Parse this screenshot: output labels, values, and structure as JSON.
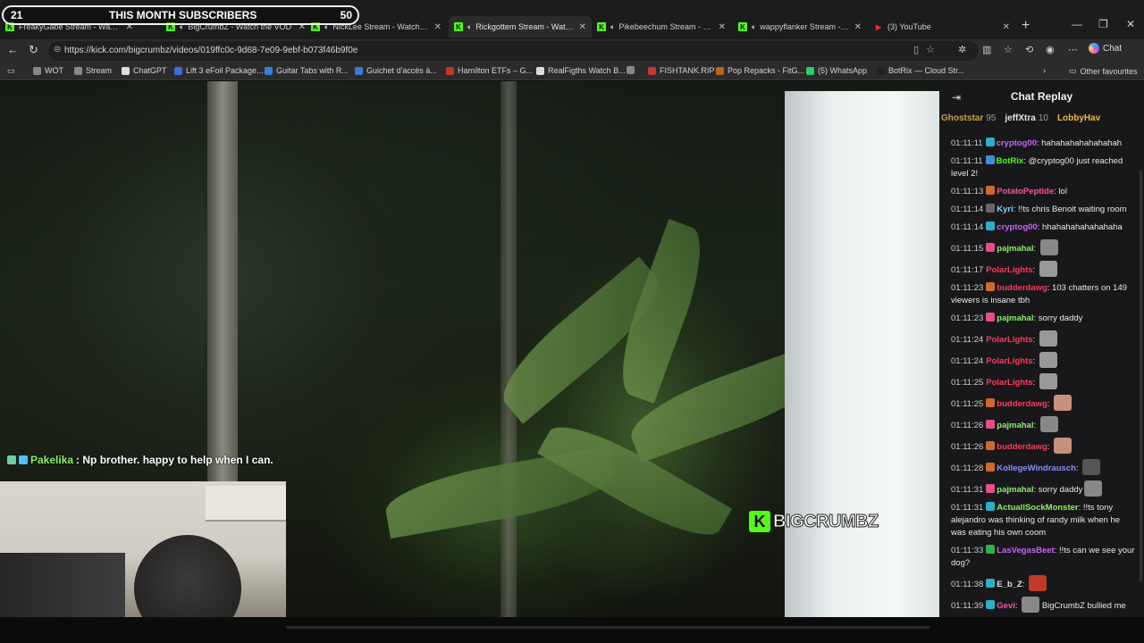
{
  "overlay": {
    "count_left": "21",
    "label": "THIS MONTH SUBSCRIBERS",
    "count_right": "50"
  },
  "tabs": [
    {
      "title": "FreakyGabe Stream - Watch",
      "icon": "kick",
      "active": false
    },
    {
      "title": "BigCrumbZ - Watch the VOD",
      "icon": "kick",
      "active": false,
      "audio": true
    },
    {
      "title": "NickLee Stream - Watch Live",
      "icon": "kick",
      "active": false,
      "audio": true
    },
    {
      "title": "Rickgottem Stream - Watch Li",
      "icon": "kick",
      "active": true,
      "audio": true
    },
    {
      "title": "Pikebeechum Stream - Watch",
      "icon": "kick",
      "active": false,
      "audio": true
    },
    {
      "title": "wappyflanker Stream - Watch",
      "icon": "kick",
      "active": false,
      "audio": true
    },
    {
      "title": "(3) YouTube",
      "icon": "youtube",
      "active": false
    }
  ],
  "address": {
    "url": "https://kick.com/bigcrumbz/videos/019ffc0c-9d68-7e09-9ebf-b073f46b9f0e"
  },
  "copilot": {
    "label": "Chat"
  },
  "bookmarks": [
    {
      "label": "WOT",
      "color": "#888"
    },
    {
      "label": "Stream",
      "color": "#888"
    },
    {
      "label": "ChatGPT",
      "color": "#ddd"
    },
    {
      "label": "Lift 3 eFoil Package...",
      "color": "#3a6fd8"
    },
    {
      "label": "Guitar Tabs with R...",
      "color": "#3c7ddc"
    },
    {
      "label": "Guichet d'accès à...",
      "color": "#3a7bd5"
    },
    {
      "label": "Hamilton ETFs – G...",
      "color": "#c0392b"
    },
    {
      "label": "RealFigths Watch B...",
      "color": "#ddd"
    },
    {
      "label": "",
      "color": "#888"
    },
    {
      "label": "FISHTANK.RIP",
      "color": "#c33"
    },
    {
      "label": "Pop Repacks - FitG...",
      "color": "#b5651d"
    },
    {
      "label": "(5) WhatsApp",
      "color": "#25d366"
    },
    {
      "label": "BotRix — Cloud Str...",
      "color": "#222"
    }
  ],
  "other_favourites": "Other favourites",
  "video": {
    "caption_name": "Pakelika",
    "caption_text": ": Np brother. happy to help when I can.",
    "watermark": "BIGCRUMBZ"
  },
  "chat": {
    "title": "Chat Replay",
    "gifters": [
      {
        "name": "Ghoststar",
        "count": "95",
        "color": "#c7a24b"
      },
      {
        "name": "jeffXtra",
        "count": "10",
        "color": "#e6e6e6"
      },
      {
        "name": "LobbyHav",
        "count": "",
        "color": "#e8b84a"
      }
    ],
    "messages": [
      {
        "time": "01:11:11",
        "name": "cryptog00",
        "color": "#c467f2",
        "badge": "#2ab0c8",
        "text": "hahahahahahahahah"
      },
      {
        "time": "01:11:11",
        "name": "BotRix",
        "color": "#53fc18",
        "badge": "#3a8fd8",
        "text": "@cryptog00 just reached level 2!"
      },
      {
        "time": "01:11:13",
        "name": "PotatoPeptide",
        "color": "#ff4fa0",
        "badge": "#d06a2a",
        "text": "lol"
      },
      {
        "time": "01:11:14",
        "name": "Kyri",
        "color": "#7fd0ff",
        "badge": "#666",
        "text": "!!ts chris Benoit waiting room"
      },
      {
        "time": "01:11:14",
        "name": "cryptog00",
        "color": "#c467f2",
        "badge": "#2ab0c8",
        "text": "hhahahahahahahaha"
      },
      {
        "time": "01:11:15",
        "name": "pajmahal",
        "color": "#8cf06a",
        "badge": "#e84c8b",
        "text": "",
        "emote": "#888"
      },
      {
        "time": "01:11:17",
        "name": "PolarLights",
        "color": "#ff3b5c",
        "badge": "",
        "text": "",
        "emote": "#999"
      },
      {
        "time": "01:11:23",
        "name": "budderdawg",
        "color": "#ff3b5c",
        "badge": "#d06a2a",
        "text": "103 chatters on 149 viewers is insane tbh"
      },
      {
        "time": "01:11:23",
        "name": "pajmahal",
        "color": "#8cf06a",
        "badge": "#e84c8b",
        "text": "sorry daddy"
      },
      {
        "time": "01:11:24",
        "name": "PolarLights",
        "color": "#ff3b5c",
        "badge": "",
        "text": "",
        "emote": "#999"
      },
      {
        "time": "01:11:24",
        "name": "PolarLights",
        "color": "#ff3b5c",
        "badge": "",
        "text": "",
        "emote": "#999"
      },
      {
        "time": "01:11:25",
        "name": "PolarLights",
        "color": "#ff3b5c",
        "badge": "",
        "text": "",
        "emote": "#999"
      },
      {
        "time": "01:11:25",
        "name": "budderdawg",
        "color": "#ff3b5c",
        "badge": "#d06a2a",
        "text": "",
        "emote": "#c8907a"
      },
      {
        "time": "01:11:26",
        "name": "pajmahal",
        "color": "#8cf06a",
        "badge": "#e84c8b",
        "text": "",
        "emote": "#888"
      },
      {
        "time": "01:11:26",
        "name": "budderdawg",
        "color": "#ff3b5c",
        "badge": "#d06a2a",
        "text": "",
        "emote": "#c8907a"
      },
      {
        "time": "01:11:28",
        "name": "KollegeWindrausch",
        "color": "#8a8aff",
        "badge": "#d06a2a",
        "text": "",
        "emote": "#555"
      },
      {
        "time": "01:11:31",
        "name": "pajmahal",
        "color": "#8cf06a",
        "badge": "#e84c8b",
        "text": "sorry daddy",
        "emote": "#888"
      },
      {
        "time": "01:11:31",
        "name": "ActuallSockMonster",
        "color": "#8cf06a",
        "badge": "#2ab0c8",
        "text": "!!ts tony alejandro was thinking of randy milk when he was eating his own coom"
      },
      {
        "time": "01:11:33",
        "name": "LasVegasBeet",
        "color": "#c467f2",
        "badge": "#2ab04c",
        "text": "!!ts can we see your dog?"
      },
      {
        "time": "01:11:38",
        "name": "E_b_Z",
        "color": "#e6e6e6",
        "badge": "#2ab0c8",
        "text": "",
        "emote": "#c0392b"
      },
      {
        "time": "01:11:39",
        "name": "Gevi",
        "color": "#ff4fa0",
        "badge": "#2ab0c8",
        "text": "BigCrumbZ bullied me",
        "emote_before": "#888"
      }
    ]
  }
}
